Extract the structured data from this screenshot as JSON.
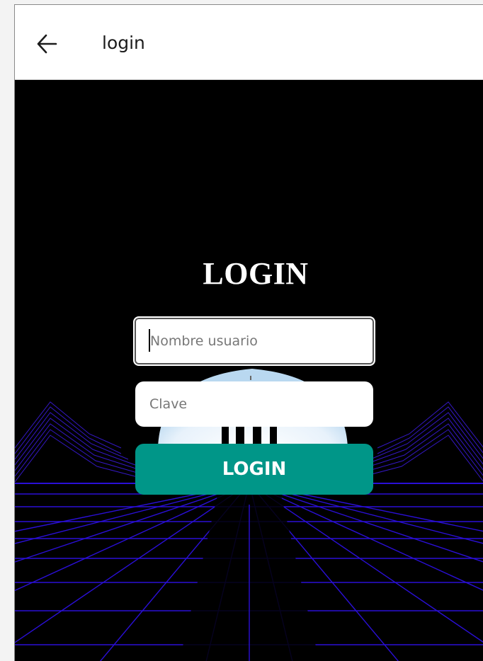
{
  "appbar": {
    "title": "login",
    "back_icon": "arrow-left-icon"
  },
  "form": {
    "heading": "LOGIN",
    "username_placeholder": "Nombre usuario",
    "password_placeholder": "Clave",
    "submit_label": "LOGIN"
  },
  "colors": {
    "button": "#009688",
    "background": "#000000",
    "grid": "#2a0fd6",
    "mountain": "#3a1bd9"
  }
}
